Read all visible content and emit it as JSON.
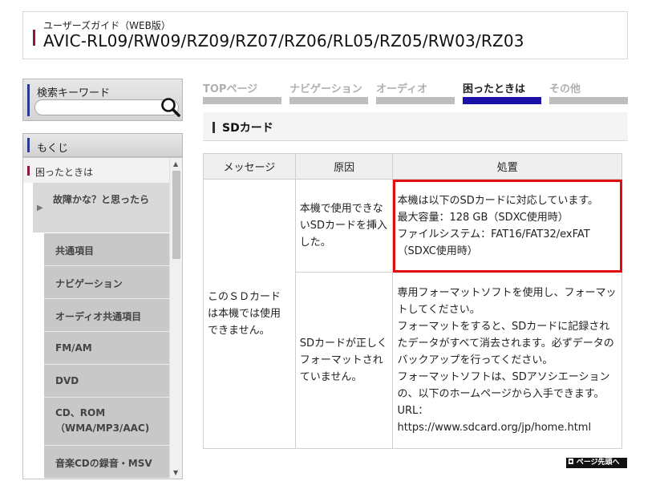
{
  "header": {
    "subtitle": "ユーザーズガイド（WEB版）",
    "model": "AVIC-RL09/RW09/RZ09/RZ07/RZ06/RL05/RZ05/RW03/RZ03"
  },
  "search": {
    "label": "検索キーワード",
    "value": "",
    "placeholder": "",
    "button_icon": "magnifier-icon"
  },
  "toc": {
    "title": "もくじ",
    "category": "困ったときは",
    "subcategory": "故障かな？と思ったら",
    "items": [
      "共通項目",
      "ナビゲーション",
      "オーディオ共通項目",
      "FM/AM",
      "DVD",
      "CD、ROM（WMA/MP3/AAC)",
      "音楽CDの録音・MSV"
    ]
  },
  "tabs": [
    {
      "label": "TOPページ"
    },
    {
      "label": "ナビゲーション"
    },
    {
      "label": "オーディオ"
    },
    {
      "label": "困ったときは"
    },
    {
      "label": "その他"
    }
  ],
  "section": {
    "title": "SDカード"
  },
  "table": {
    "headers": [
      "メッセージ",
      "原因",
      "処置"
    ],
    "message": "このＳＤカードは本機では使用できません。",
    "rows": [
      {
        "cause": "本機で使用できないSDカードを挿入した。",
        "action": [
          "本機は以下のSDカードに対応しています。",
          "最大容量：128 GB（SDXC使用時）",
          "ファイルシステム：FAT16/FAT32/exFAT（SDXC使用時）"
        ]
      },
      {
        "cause": "SDカードが正しくフォーマットされていません。",
        "action": [
          "専用フォーマットソフトを使用し、フォーマットしてください。",
          "フォーマットをすると、SDカードに記録されたデータがすべて消去されます。必ずデータのバックアップを行ってください。",
          "フォーマットソフトは、SDアソシエーションの、以下のホームページから入手できます。",
          "URL：",
          "https://www.sdcard.org/jp/home.html"
        ]
      }
    ]
  },
  "pagetop": {
    "label": "ページ先頭へ"
  },
  "colors": {
    "accent_red": "#8b1a3a",
    "accent_blue": "#2a3b8f",
    "active_tab": "#1d12a8",
    "highlight": "#e30d0d"
  }
}
